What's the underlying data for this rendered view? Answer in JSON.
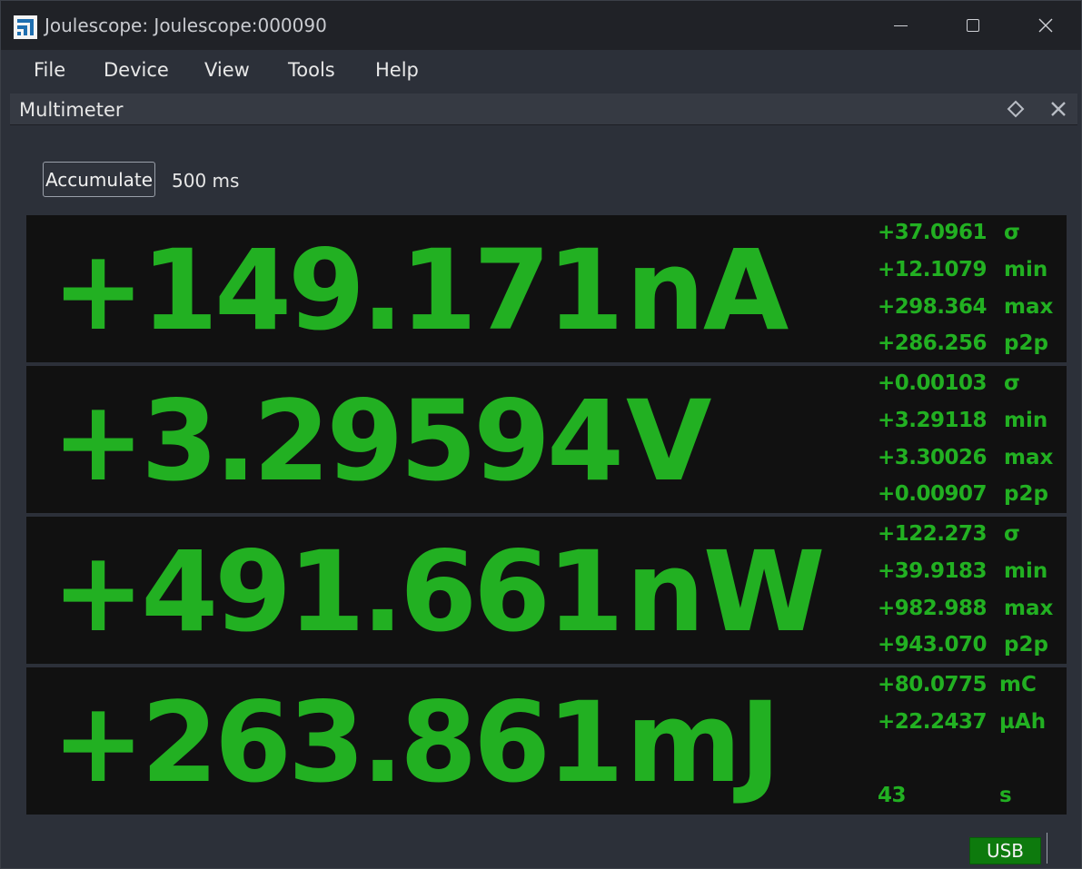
{
  "window": {
    "title": "Joulescope: Joulescope:000090",
    "icon": "joulescope-logo-icon"
  },
  "menu": {
    "items": [
      {
        "label": "File"
      },
      {
        "label": "Device"
      },
      {
        "label": "View"
      },
      {
        "label": "Tools"
      },
      {
        "label": "Help"
      }
    ]
  },
  "dock": {
    "title": "Multimeter",
    "float_icon": "float-diamond-icon",
    "close_icon": "close-icon"
  },
  "controls": {
    "accumulate_label": "Accumulate",
    "interval": "500 ms"
  },
  "meters": {
    "current": {
      "value": "+149.171",
      "unit": "nA",
      "stats": [
        {
          "value": "+37.0961",
          "label": "σ"
        },
        {
          "value": "+12.1079",
          "label": "min"
        },
        {
          "value": "+298.364",
          "label": "max"
        },
        {
          "value": "+286.256",
          "label": "p2p"
        }
      ]
    },
    "voltage": {
      "value": "+3.29594",
      "unit": "V",
      "stats": [
        {
          "value": "+0.00103",
          "label": "σ"
        },
        {
          "value": "+3.29118",
          "label": "min"
        },
        {
          "value": "+3.30026",
          "label": "max"
        },
        {
          "value": "+0.00907",
          "label": "p2p"
        }
      ]
    },
    "power": {
      "value": "+491.661",
      "unit": "nW",
      "stats": [
        {
          "value": "+122.273",
          "label": "σ"
        },
        {
          "value": "+39.9183",
          "label": "min"
        },
        {
          "value": "+982.988",
          "label": "max"
        },
        {
          "value": "+943.070",
          "label": "p2p"
        }
      ]
    },
    "energy": {
      "value": "+263.861",
      "unit": "mJ",
      "stats": [
        {
          "value": "+80.0775",
          "label": "mC"
        },
        {
          "value": "+22.2437",
          "label": "µAh"
        },
        {
          "value": "",
          "label": ""
        },
        {
          "value": "43",
          "label": "s"
        }
      ]
    }
  },
  "status": {
    "connection": "USB"
  },
  "colors": {
    "meter_green": "#22b022",
    "meter_background": "#111111",
    "window_background": "#2c3039",
    "usb_badge": "#0d7a0d"
  }
}
